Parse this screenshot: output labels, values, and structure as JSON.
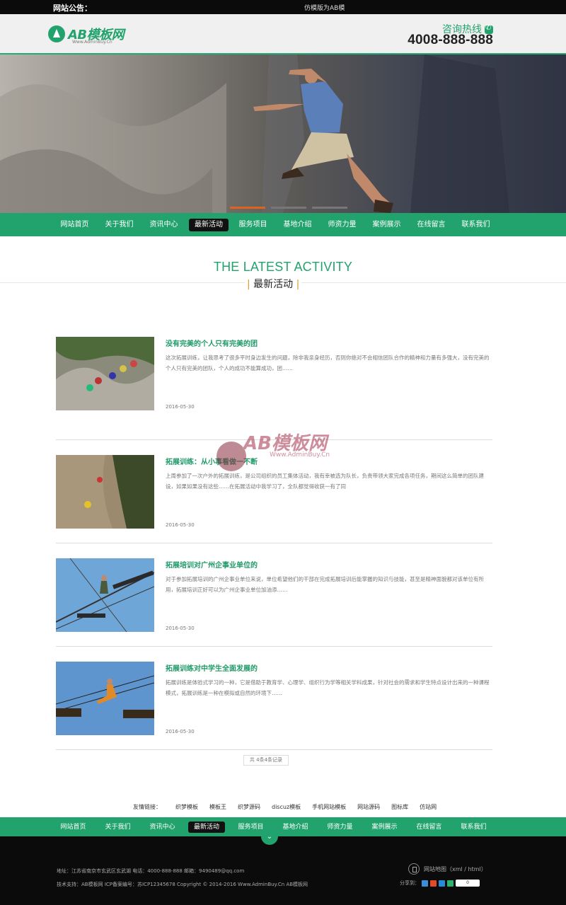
{
  "notice": {
    "label": "网站公告：",
    "text": "仿模版为AB模"
  },
  "header": {
    "logo_name": "AB模板网",
    "logo_sub": "Www.AdminBuy.Cn",
    "hotline_label": "咨询热线",
    "hotline_number": "4008-888-888"
  },
  "nav": {
    "items": [
      "网站首页",
      "关于我们",
      "资讯中心",
      "最新活动",
      "服务项目",
      "基地介绍",
      "师资力量",
      "案例展示",
      "在线留言",
      "联系我们"
    ],
    "active_index": 3
  },
  "section": {
    "title_en": "THE LATEST ACTIVITY",
    "title_cn": "最新活动"
  },
  "articles": [
    {
      "title": "没有完美的个人只有完美的团",
      "summary": "这次拓展训练，让我思考了很多平时身边发生的问题，除非我亲身经历，否则你绝对不会相信团队合作的精神和力量有多强大，没有完美的个人只有完美的团队，个人的成功不能算成功，团……",
      "date": "2016-05-30"
    },
    {
      "title": "拓展训练：从小事看做一不断",
      "summary": "上周参加了一次户外的拓展训练，是公司组织的员工集体活动，我有幸被选为队长，负责带领大家完成各项任务，期间这么简单的团队建设，如果如果没有这些……在拓展活动中我学习了，全队都觉得收获一有了同",
      "date": "2016-05-30"
    },
    {
      "title": "拓展培训对广州企事业单位的",
      "summary": "对于参加拓展培训的广州企事业单位来说，单位希望他们的干部在完成拓展培训后能掌握的知识与技能，甚至是精神面貌都对该单位有所用，拓展培训正好可以为广州企事业单位加油添……",
      "date": "2016-05-30"
    },
    {
      "title": "拓展训练对中学生全面发展的",
      "summary": "拓展训练是体验式学习的一种，它是借助于教育学、心理学、组织行为学等相关学科成果，针对社会的需求和学生特点设计出来的一种课程模式，拓展训练是一种在模拟或自然的环境下……",
      "date": "2016-05-30"
    }
  ],
  "watermark": {
    "name": "AB模板网",
    "sub": "Www.AdminBuy.Cn"
  },
  "pager": {
    "text": "共 4条4条记录"
  },
  "friend_links": {
    "label": "友情链接：",
    "items": [
      "织梦模板",
      "模板王",
      "织梦源码",
      "discuz模板",
      "手机网站模板",
      "网站源码",
      "图标库",
      "仿站网"
    ]
  },
  "footer": {
    "line1": "地址：江苏省南京市玄武区玄武湖  电话：4000-888-888  邮箱：9490489@qq.com",
    "line2": "技术支持：AB模板网  ICP备案编号：苏ICP12345678 Copyright © 2014-2016 Www.AdminBuy.Cn AB模板网",
    "sitemap": "网站地图（xml / html）",
    "share_label": "分享到：",
    "share_count": "0"
  }
}
